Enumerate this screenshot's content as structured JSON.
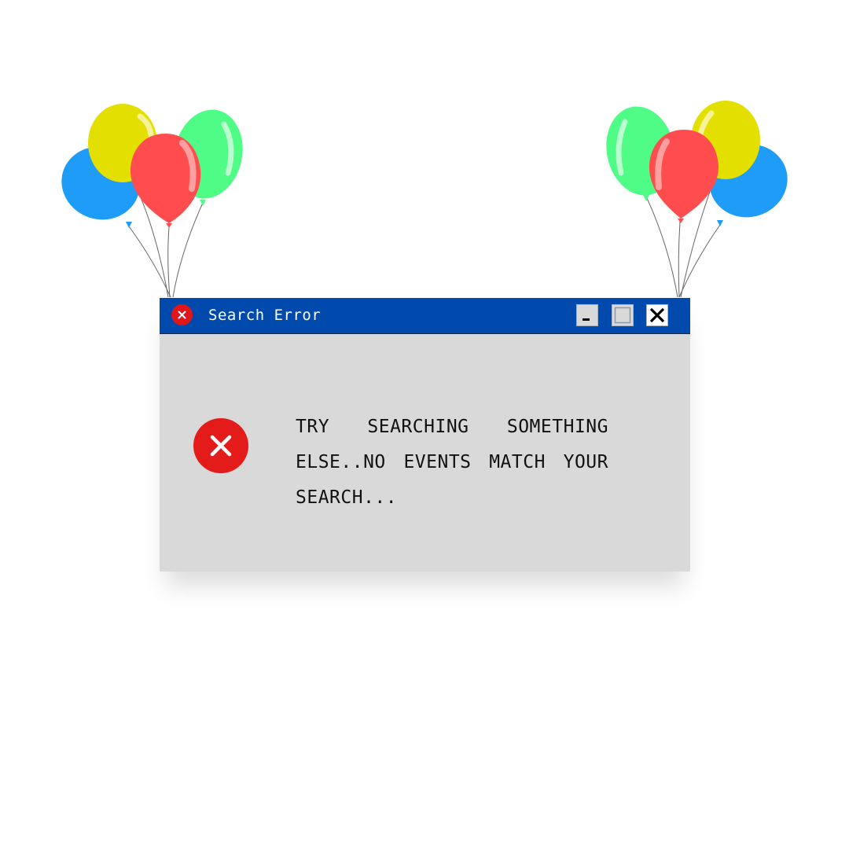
{
  "window": {
    "title": "Search Error",
    "message": "TRY SEARCHING SOMETHING ELSE..NO EVENTS MATCH YOUR SEARCH...",
    "icons": {
      "title_icon": "error-icon",
      "body_icon": "error-icon",
      "minimize": "minimize-icon",
      "maximize": "maximize-icon",
      "close": "close-icon"
    }
  },
  "decorations": {
    "left_balloons": [
      "blue",
      "yellow",
      "green",
      "red"
    ],
    "right_balloons": [
      "blue",
      "yellow",
      "green",
      "red"
    ]
  },
  "colors": {
    "titlebar": "#004aad",
    "window_body": "#d9d9d9",
    "error_red": "#e31b1b",
    "balloon_blue": "#1e9cf7",
    "balloon_yellow": "#e3e000",
    "balloon_green": "#4ffc85",
    "balloon_red": "#ff4d4f"
  }
}
